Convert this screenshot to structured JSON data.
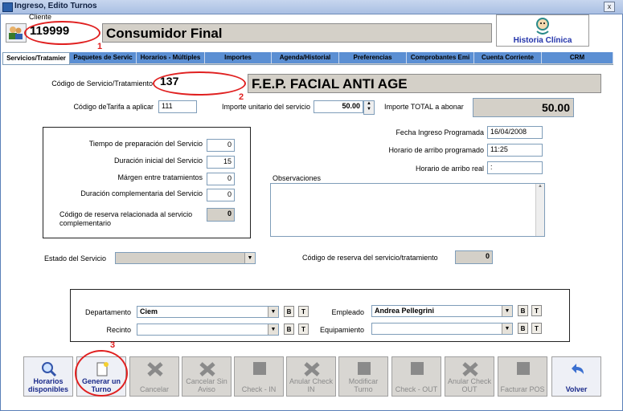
{
  "window": {
    "title": "Ingreso, Edito Turnos",
    "close_label": "x"
  },
  "cliente": {
    "label": "Cliente",
    "code": "119999",
    "name": "Consumidor Final"
  },
  "historia_button": "Historia Clínica",
  "tabs": [
    "Servicios/Tratamier",
    "Paquetes de Servic",
    "Horarios - Múltiples",
    "Importes",
    "Agenda/Historial",
    "Preferencias",
    "Comprobantes Emi",
    "Cuenta Corriente",
    "CRM"
  ],
  "servicio": {
    "code_label": "Código de Servicio/Tratamiento",
    "code": "137",
    "name": "F.E.P.  FACIAL ANTI AGE",
    "tarifa_label": "Código deTarifa a aplicar",
    "tarifa": "111",
    "unit_label": "Importe unitario del servicio",
    "unit": "50.00",
    "total_label": "Importe TOTAL a abonar",
    "total": "50.00"
  },
  "tiempos": {
    "prep_label": "Tiempo de preparación del Servicio",
    "prep": "0",
    "dur_label": "Duración inicial del Servicio",
    "dur": "15",
    "margen_label": "Márgen entre tratamientos",
    "margen": "0",
    "comp_label": "Duración  complementaria  del Servicio",
    "comp": "0",
    "reserva_label_1": "Código de reserva relacionada al  servicio",
    "reserva_label_2": "complementario",
    "reserva": "0"
  },
  "fechas": {
    "fecha_label": "Fecha Ingreso Programada",
    "fecha": "16/04/2008",
    "arribo_prog_label": "Horario de arribo programado",
    "arribo_prog": "11:25",
    "arribo_real_label": "Horario de arribo real",
    "arribo_real": " :"
  },
  "observaciones_label": "Observaciones",
  "estado_label": "Estado del Servicio",
  "reserva_serv_label": "Código de reserva del servicio/tratamiento",
  "reserva_serv": "0",
  "asignacion": {
    "depto_label": "Departamento",
    "depto": "Ciem",
    "recinto_label": "Recinto",
    "recinto": "",
    "empleado_label": "Empleado",
    "empleado": "Andrea Pellegrini",
    "equip_label": "Equipamiento",
    "equip": "",
    "b_label": "B",
    "t_label": "T"
  },
  "toolbar": [
    "Horarios disponibles",
    "Generar un Turno",
    "Cancelar",
    "Cancelar Sin Aviso",
    "Check - IN",
    "Anular Check IN",
    "Modificar Turno",
    "Check - OUT",
    "Anular Check OUT",
    "Facturar POS",
    "Volver"
  ],
  "annotations": [
    "1",
    "2",
    "3"
  ],
  "colors": {
    "tab_blue": "#5b8fd3",
    "annotation_red": "#e02020",
    "link_blue": "#2233aa"
  }
}
